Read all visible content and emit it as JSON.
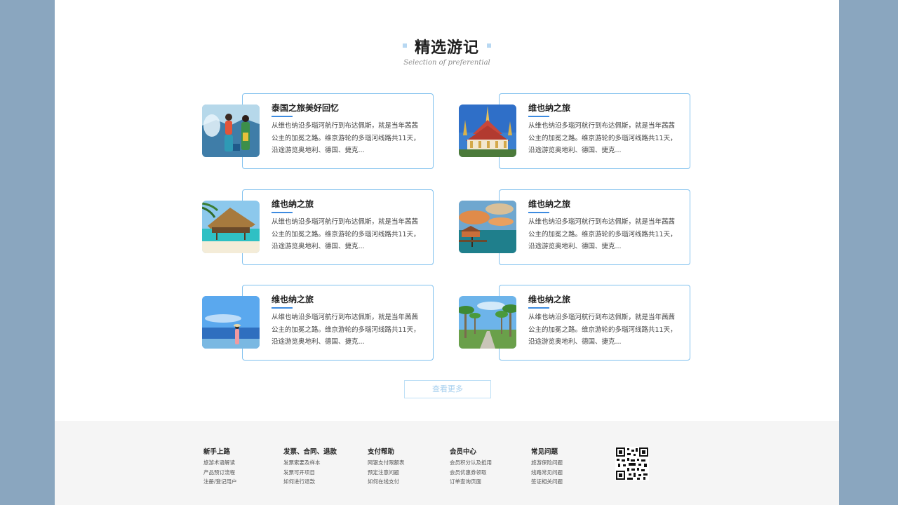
{
  "section": {
    "title": "精选游记",
    "subtitle": "Selection of preferential"
  },
  "notes": [
    {
      "title": "泰国之旅美好回忆",
      "desc": "从维也纳沿多瑙河航行到布达佩斯，就是当年茜茜公主的加冕之路。维京游轮的多瑙河线路共11天，沿途游览奥地利、德国、捷克...",
      "image_icon": "water-festival-photo"
    },
    {
      "title": "维也纳之旅",
      "desc": "从维也纳沿多瑙河航行到布达佩斯，就是当年茜茜公主的加冕之路。维京游轮的多瑙河线路共11天，沿途游览奥地利、德国、捷克...",
      "image_icon": "grand-palace-photo"
    },
    {
      "title": "维也纳之旅",
      "desc": "从维也纳沿多瑙河航行到布达佩斯，就是当年茜茜公主的加冕之路。维京游轮的多瑙河线路共11天，沿途游览奥地利、德国、捷克...",
      "image_icon": "beach-hut-photo"
    },
    {
      "title": "维也纳之旅",
      "desc": "从维也纳沿多瑙河航行到布达佩斯，就是当年茜茜公主的加冕之路。维京游轮的多瑙河线路共11天，沿途游览奥地利、德国、捷克...",
      "image_icon": "sunset-villa-photo"
    },
    {
      "title": "维也纳之旅",
      "desc": "从维也纳沿多瑙河航行到布达佩斯，就是当年茜茜公主的加冕之路。维京游轮的多瑙河线路共11天，沿途游览奥地利、德国、捷克...",
      "image_icon": "seaside-girl-photo"
    },
    {
      "title": "维也纳之旅",
      "desc": "从维也纳沿多瑙河航行到布达佩斯，就是当年茜茜公主的加冕之路。维京游轮的多瑙河线路共11天，沿途游览奥地利、德国、捷克...",
      "image_icon": "palm-road-photo"
    }
  ],
  "more_button": "查看更多",
  "footer": {
    "columns": [
      {
        "title": "新手上路",
        "links": [
          "旅游术语解读",
          "产品预订流程",
          "注册/登记用户"
        ]
      },
      {
        "title": "发票、合同、退款",
        "links": [
          "发票索要及样本",
          "发票可开项目",
          "如何进行退款"
        ]
      },
      {
        "title": "支付帮助",
        "links": [
          "网银支付限额表",
          "预定注意问题",
          "如何在线支付"
        ]
      },
      {
        "title": "会员中心",
        "links": [
          "会员积分认及抵用",
          "会员优惠券领取",
          "订单查询页面"
        ]
      },
      {
        "title": "常见问题",
        "links": [
          "旅游保险问题",
          "线路常见问题",
          "签证相关问题"
        ]
      }
    ],
    "qr_icon": "qr-code-icon"
  },
  "colors": {
    "frame": "#8aa6bf",
    "accent": "#3d8be0",
    "card_border": "#7fc0ee",
    "footer_bg": "#f5f5f5"
  }
}
